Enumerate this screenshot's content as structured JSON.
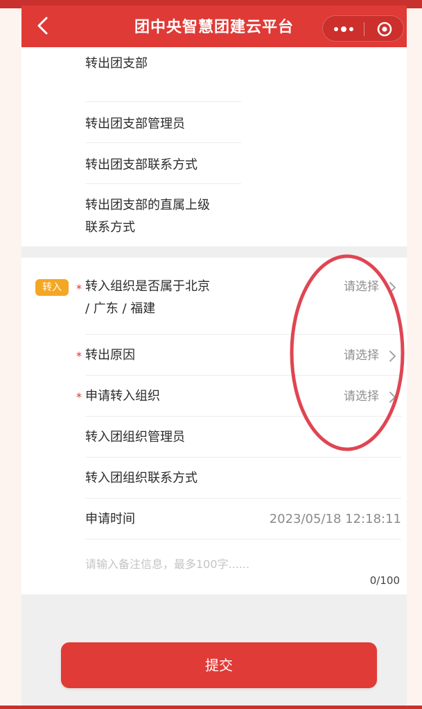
{
  "nav": {
    "title": "团中央智慧团建云平台"
  },
  "transfer_out": {
    "rows": [
      {
        "label": "转出团支部"
      },
      {
        "label": "转出团支部管理员"
      },
      {
        "label": "转出团支部联系方式"
      },
      {
        "label_line1": "转出团支部的直属上级",
        "label_line2": "联系方式"
      }
    ]
  },
  "transfer_in": {
    "tag": "转入",
    "required_mark": "*",
    "rows": [
      {
        "label_line1": "转入组织是否属于北京",
        "label_line2": "/ 广东 / 福建",
        "value": "请选择",
        "required": true
      },
      {
        "label": "转出原因",
        "value": "请选择",
        "required": true
      },
      {
        "label": "申请转入组织",
        "value": "请选择",
        "required": true
      },
      {
        "label": "转入团组织管理员"
      },
      {
        "label": "转入团组织联系方式"
      },
      {
        "label": "申请时间",
        "value": "2023/05/18 12:18:11"
      }
    ],
    "remark": {
      "placeholder": "请输入备注信息，最多100字......",
      "value": "",
      "counter": "0/100"
    }
  },
  "submit_label": "提交",
  "colors": {
    "brand_red": "#df3a36",
    "required_red": "#e02f2b",
    "tag_orange": "#f5a623",
    "annotation_red": "#e04552"
  }
}
